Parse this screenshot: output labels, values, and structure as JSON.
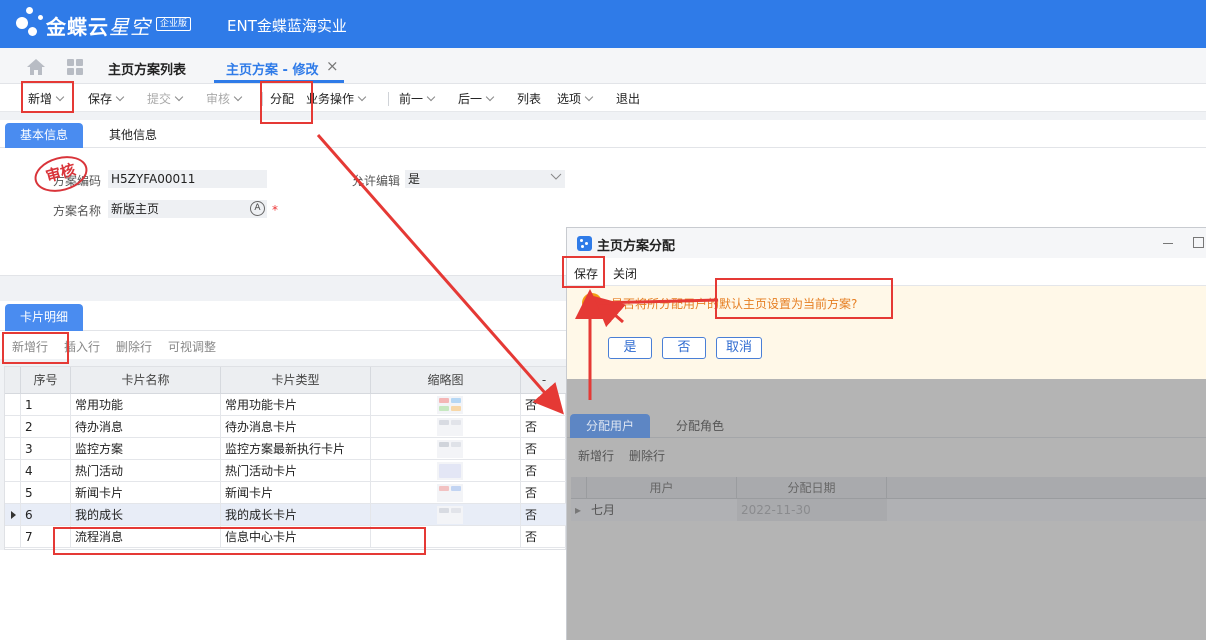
{
  "header": {
    "brand": "金蝶云",
    "brand_sub": "星空",
    "edition": "企业版",
    "company": "ENT金蝶蓝海实业"
  },
  "tabs": {
    "list": "主页方案列表",
    "edit": "主页方案 - 修改",
    "close": "×"
  },
  "toolbar": {
    "add": "新增",
    "save": "保存",
    "submit": "提交",
    "audit": "审核",
    "assign": "分配",
    "business": "业务操作",
    "prev": "前一",
    "next": "后一",
    "list": "列表",
    "options": "选项",
    "exit": "退出"
  },
  "info_tabs": {
    "basic": "基本信息",
    "other": "其他信息"
  },
  "form": {
    "stamp": "审核",
    "code_label": "方案编码",
    "code_value": "H5ZYFA00011",
    "allow_edit_label": "允许编辑",
    "allow_edit_value": "是",
    "name_label": "方案名称",
    "name_value": "新版主页",
    "required_mark": "*",
    "at_symbol": "A"
  },
  "card": {
    "tab": "卡片明细",
    "toolbar": {
      "add_row": "新增行",
      "insert_row": "插入行",
      "delete_row": "删除行",
      "visual": "可视调整"
    },
    "columns": [
      "序号",
      "卡片名称",
      "卡片类型",
      "缩略图",
      "-"
    ],
    "rows": [
      {
        "no": "1",
        "name": "常用功能",
        "type": "常用功能卡片",
        "flag": "否"
      },
      {
        "no": "2",
        "name": "待办消息",
        "type": "待办消息卡片",
        "flag": "否"
      },
      {
        "no": "3",
        "name": "监控方案",
        "type": "监控方案最新执行卡片",
        "flag": "否"
      },
      {
        "no": "4",
        "name": "热门活动",
        "type": "热门活动卡片",
        "flag": "否"
      },
      {
        "no": "5",
        "name": "新闻卡片",
        "type": "新闻卡片",
        "flag": "否"
      },
      {
        "no": "6",
        "name": "我的成长",
        "type": "我的成长卡片",
        "flag": "否"
      },
      {
        "no": "7",
        "name": "流程消息",
        "type": "信息中心卡片",
        "flag": "否"
      }
    ]
  },
  "dialog": {
    "title": "主页方案分配",
    "toolbar": {
      "save": "保存",
      "close": "关闭"
    },
    "confirm": {
      "icon": "!",
      "message": "是否将所分配用户的默认主页设置为当前方案?",
      "yes": "是",
      "no": "否",
      "cancel": "取消"
    },
    "tabs": {
      "users": "分配用户",
      "roles": "分配角色"
    },
    "sub_toolbar": {
      "add_row": "新增行",
      "delete_row": "删除行"
    },
    "columns": [
      "用户",
      "分配日期"
    ],
    "rows": [
      {
        "user": "七月",
        "date": "2022-11-30"
      }
    ]
  },
  "colors": {
    "header": "#2f7be8",
    "accent": "#4a8cf0",
    "annotation": "#e53935",
    "warning": "#e67e22"
  }
}
